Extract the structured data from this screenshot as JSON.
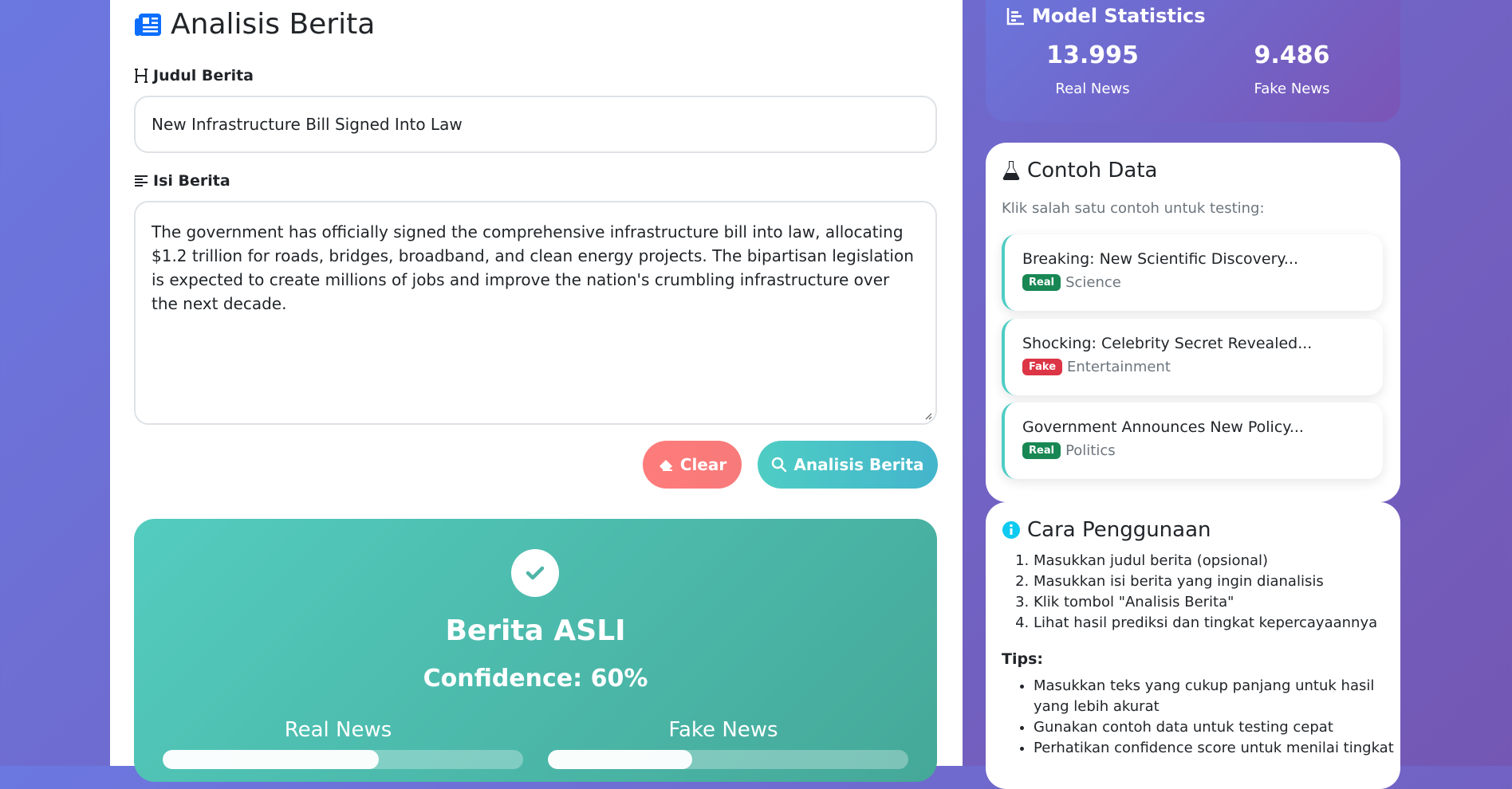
{
  "main": {
    "title": "Analisis Berita",
    "title_label": "Judul Berita",
    "title_value": "New Infrastructure Bill Signed Into Law",
    "body_label": "Isi Berita",
    "body_value": "The government has officially signed the comprehensive infrastructure bill into law, allocating $1.2 trillion for roads, bridges, broadband, and clean energy projects. The bipartisan legislation is expected to create millions of jobs and improve the nation's crumbling infrastructure over the next decade.",
    "clear_label": "Clear",
    "analyze_label": "Analisis Berita"
  },
  "result": {
    "verdict": "Berita ASLI",
    "confidence": "Confidence: 60%",
    "real_label": "Real News",
    "fake_label": "Fake News",
    "real_fraction": 0.6,
    "fake_fraction": 0.4
  },
  "stats": {
    "title": "Model Statistics",
    "real_count": "13.995",
    "real_label": "Real News",
    "fake_count": "9.486",
    "fake_label": "Fake News"
  },
  "samples": {
    "title": "Contoh Data",
    "hint": "Klik salah satu contoh untuk testing:",
    "items": [
      {
        "title": "Breaking: New Scientific Discovery...",
        "badge": "Real",
        "category": "Science"
      },
      {
        "title": "Shocking: Celebrity Secret Revealed...",
        "badge": "Fake",
        "category": "Entertainment"
      },
      {
        "title": "Government Announces New Policy...",
        "badge": "Real",
        "category": "Politics"
      }
    ]
  },
  "usage": {
    "title": "Cara Penggunaan",
    "steps": [
      "Masukkan judul berita (opsional)",
      "Masukkan isi berita yang ingin dianalisis",
      "Klik tombol \"Analisis Berita\"",
      "Lihat hasil prediksi dan tingkat kepercayaannya"
    ],
    "tips_label": "Tips:",
    "tips": [
      "Masukkan teks yang cukup panjang untuk hasil yang lebih akurat",
      "Gunakan contoh data untuk testing cepat",
      "Perhatikan confidence score untuk menilai tingkat"
    ]
  },
  "colors": {
    "accent_teal": "#4ecdc4",
    "clear_red": "#ff7b7b",
    "real_badge": "#198754",
    "fake_badge": "#dc3545",
    "info_icon": "#0dcaf0"
  },
  "icons": [
    "newspaper-icon",
    "heading-icon",
    "align-left-icon",
    "eraser-icon",
    "search-icon",
    "check-icon",
    "chart-bar-icon",
    "flask-icon",
    "info-icon"
  ]
}
